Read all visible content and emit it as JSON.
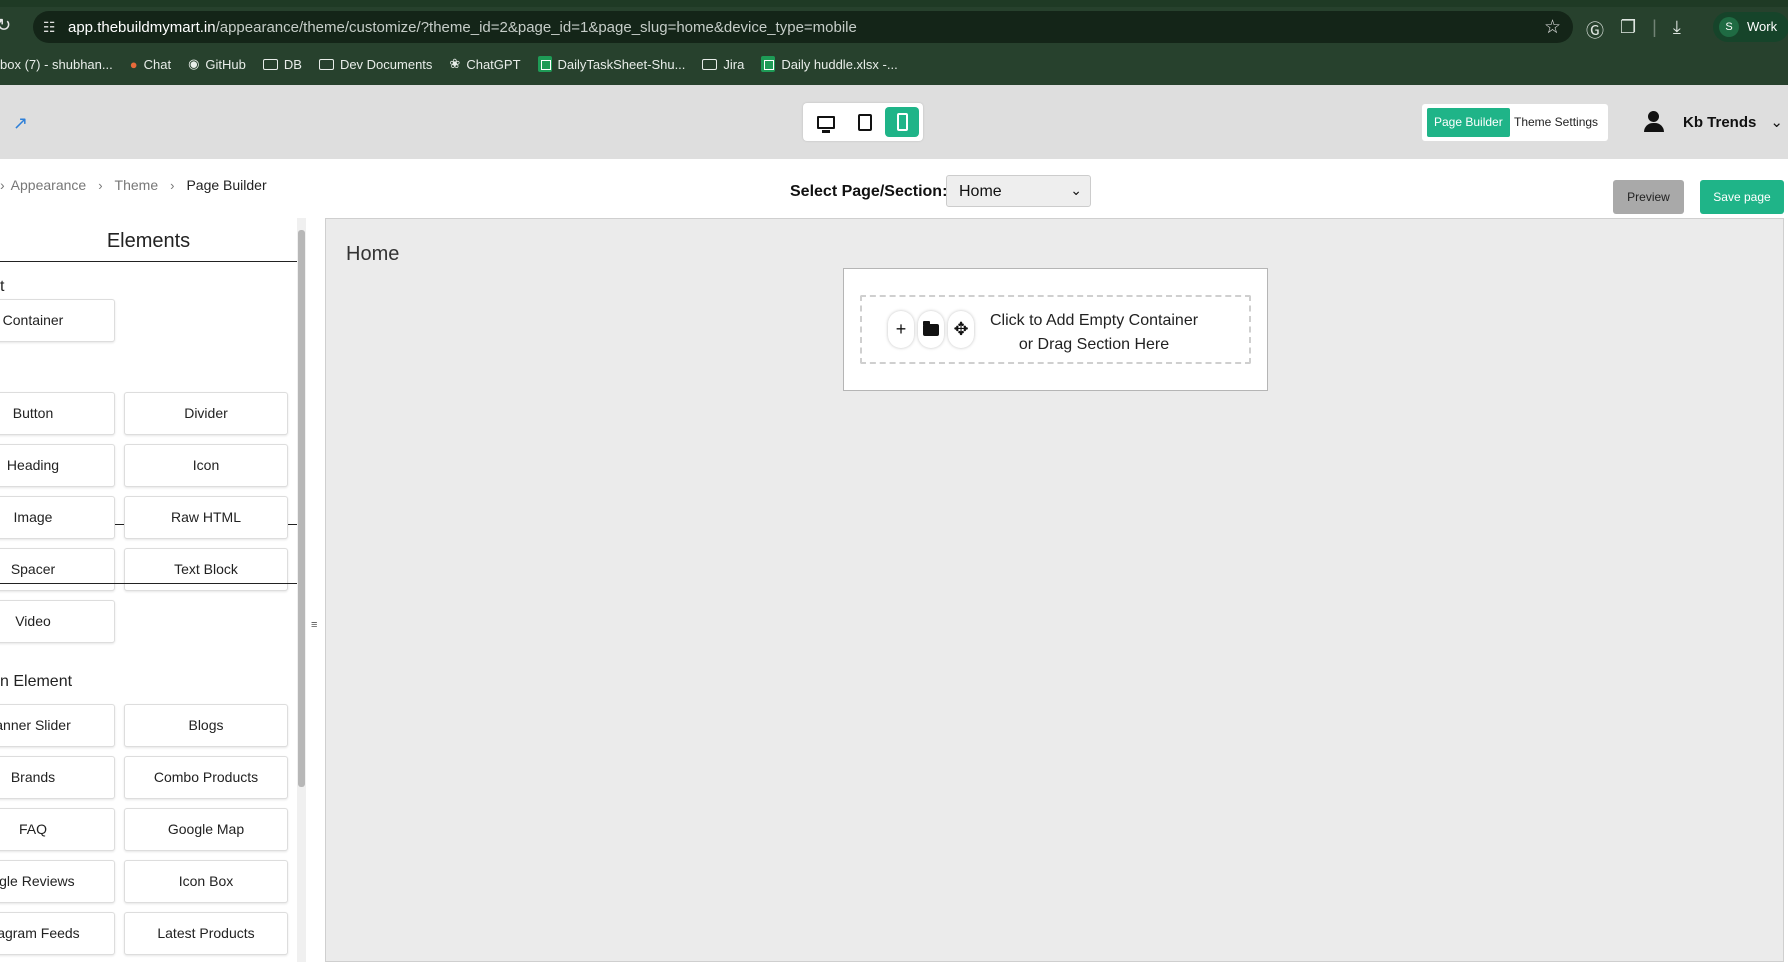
{
  "browser": {
    "url_host": "app.thebuildmymart.in",
    "url_path": "/appearance/theme/customize/?theme_id=2&page_id=1&page_slug=home&device_type=mobile",
    "profile_initial": "S",
    "profile_name": "Work",
    "bookmarks": [
      {
        "label": "box (7) - shubhan...",
        "icon": "mail-icon"
      },
      {
        "label": "Chat",
        "icon": "chat-icon"
      },
      {
        "label": "GitHub",
        "icon": "github-icon"
      },
      {
        "label": "DB",
        "icon": "folder-icon"
      },
      {
        "label": "Dev Documents",
        "icon": "folder-icon"
      },
      {
        "label": "ChatGPT",
        "icon": "chatgpt-icon"
      },
      {
        "label": "DailyTaskSheet-Shu...",
        "icon": "sheets-icon"
      },
      {
        "label": "Jira",
        "icon": "folder-icon"
      },
      {
        "label": "Daily huddle.xlsx -...",
        "icon": "sheets-icon"
      }
    ]
  },
  "header": {
    "devices": [
      "desktop",
      "tablet",
      "mobile"
    ],
    "active_device": "mobile",
    "mode_page_builder": "Page Builder",
    "mode_theme_settings": "Theme Settings",
    "user_name": "Kb Trends"
  },
  "toolbar": {
    "breadcrumb": [
      "Appearance",
      "Theme",
      "Page Builder"
    ],
    "select_label": "Select Page/Section:",
    "select_value": "Home",
    "preview_label": "Preview",
    "save_label": "Save page"
  },
  "elements_panel": {
    "title": "Elements",
    "group1_label": "t",
    "group1_items": [
      "Container"
    ],
    "group2_items": [
      "Button",
      "Divider",
      "Heading",
      "Icon",
      "Image",
      "Raw HTML",
      "Spacer",
      "Text Block",
      "Video"
    ],
    "group3_label": "n Element",
    "group3_items": [
      "anner Slider",
      "Blogs",
      "Brands",
      "Combo Products",
      "FAQ",
      "Google Map",
      "ogle Reviews",
      "Icon Box",
      "stagram Feeds",
      "Latest Products"
    ]
  },
  "canvas": {
    "title": "Home",
    "dropzone_line1": "Click to Add Empty Container",
    "dropzone_line2": "or Drag Section Here"
  },
  "colors": {
    "accent": "#1fb488",
    "browser_frame": "#27412d",
    "link": "#2d7fd8"
  }
}
